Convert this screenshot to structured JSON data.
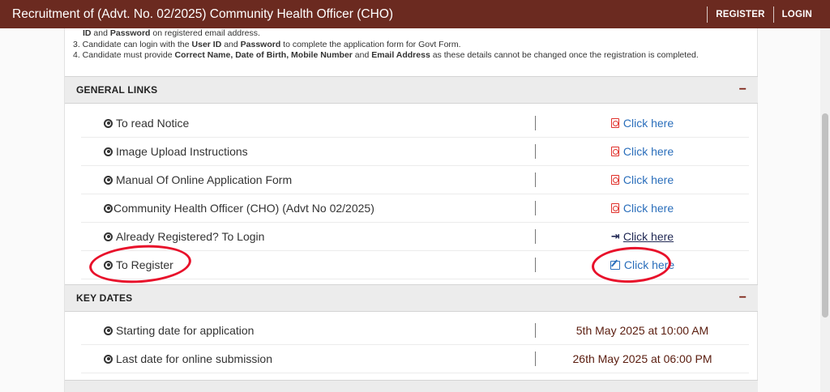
{
  "header": {
    "title": "Recruitment of (Advt. No. 02/2025) Community Health Officer (CHO)",
    "register_label": "REGISTER",
    "login_label": "LOGIN"
  },
  "instructions": {
    "line1_b1": "ID",
    "line1_mid": " and ",
    "line1_b2": "Password",
    "line1_end": " on registered email address.",
    "line2_start": "3. Candidate can login with the ",
    "line2_b1": "User ID",
    "line2_mid": " and ",
    "line2_b2": "Password",
    "line2_end": " to complete the application form for Govt Form.",
    "line3_start": "4. Candidate must provide ",
    "line3_b1": "Correct Name, Date of Birth, Mobile Number",
    "line3_mid": " and ",
    "line3_b2": "Email Address",
    "line3_end": " as these details cannot be changed once the registration is completed."
  },
  "general_links": {
    "heading": "GENERAL LINKS",
    "toggle": "−",
    "rows": [
      {
        "label": "To read Notice",
        "action": "Click here"
      },
      {
        "label": "Image Upload Instructions",
        "action": "Click here"
      },
      {
        "label": "Manual Of Online Application Form",
        "action": "Click here"
      },
      {
        "label": "Community Health Officer (CHO) (Advt No 02/2025)",
        "action": "Click here"
      },
      {
        "label": "Already Registered? To Login",
        "action": "Click here"
      },
      {
        "label": "To Register",
        "action": "Click here"
      }
    ]
  },
  "key_dates": {
    "heading": "KEY DATES",
    "toggle": "−",
    "rows": [
      {
        "label": "Starting date for application",
        "value": "5th May 2025 at 10:00 AM"
      },
      {
        "label": "Last date for online submission",
        "value": "26th May 2025 at 06:00 PM"
      }
    ]
  },
  "colors": {
    "header_bg": "#6b2a20",
    "link": "#2a6ebb",
    "date": "#5a1c0e",
    "annotation": "#e8102a"
  },
  "icons": {
    "row_bullet": "dot-circle-icon",
    "pdf": "file-pdf-icon",
    "login": "sign-in-icon",
    "register": "edit-icon"
  }
}
